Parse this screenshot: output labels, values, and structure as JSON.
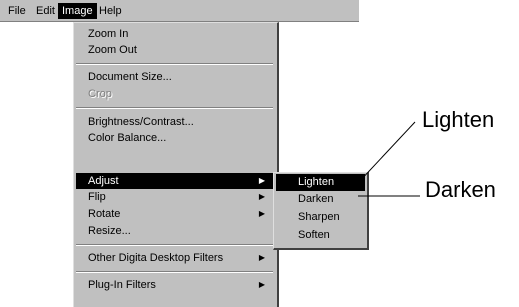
{
  "menubar": {
    "items": [
      {
        "label": "File",
        "active": false
      },
      {
        "label": "Edit",
        "active": false
      },
      {
        "label": "Image",
        "active": true
      },
      {
        "label": "Help",
        "active": false
      }
    ]
  },
  "image_menu": {
    "zoom_in": "Zoom In",
    "zoom_out": "Zoom Out",
    "document_size": "Document Size...",
    "crop": "Crop",
    "brightness_contrast": "Brightness/Contrast...",
    "color_balance": "Color Balance...",
    "adjust": "Adjust",
    "flip": "Flip",
    "rotate": "Rotate",
    "resize": "Resize...",
    "other_filters": "Other Digita Desktop Filters",
    "plugin_filters": "Plug-In Filters",
    "submenu_arrow": "▶"
  },
  "adjust_submenu": {
    "lighten": "Lighten",
    "darken": "Darken",
    "sharpen": "Sharpen",
    "soften": "Soften"
  },
  "callouts": {
    "lighten": "Lighten",
    "darken": "Darken"
  }
}
